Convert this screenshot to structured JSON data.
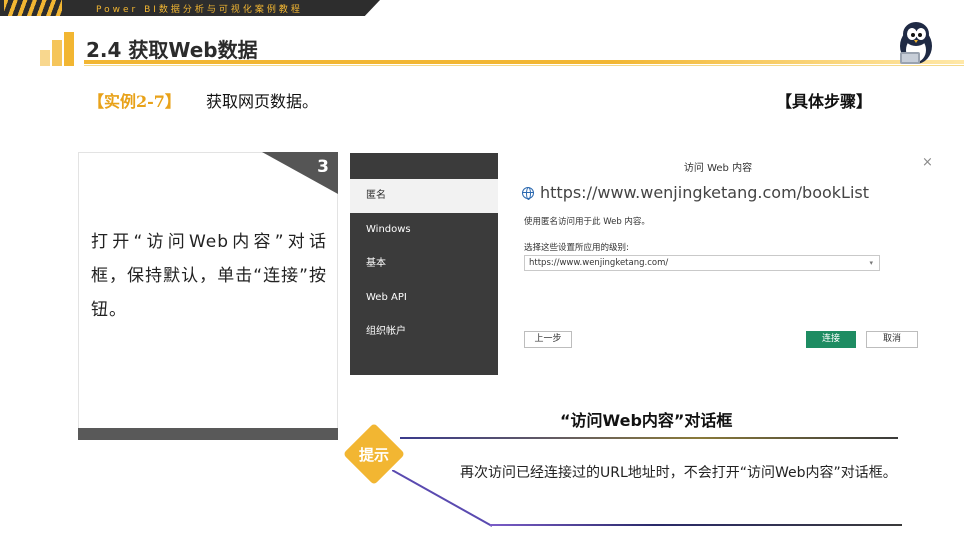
{
  "header": {
    "course": "Power BI数据分析与可视化案例教程",
    "section_title": "2.4 获取Web数据"
  },
  "example": {
    "tag": "【实例2-7】",
    "text": "获取网页数据。",
    "steps_label": "【具体步骤】"
  },
  "step": {
    "number": "3",
    "text": "打开“访问Web内容”对话框，保持默认，单击“连接”按钮。"
  },
  "dialog": {
    "title": "访问 Web 内容",
    "close": "×",
    "sidebar": [
      {
        "label": "匿名",
        "active": true
      },
      {
        "label": "Windows",
        "active": false
      },
      {
        "label": "基本",
        "active": false
      },
      {
        "label": "Web API",
        "active": false
      },
      {
        "label": "组织帐户",
        "active": false
      }
    ],
    "url": "https://www.wenjingketang.com/bookList",
    "anon_text": "使用匿名访问用于此 Web 内容。",
    "level_label": "选择这些设置所应用的级别:",
    "level_value": "https://www.wenjingketang.com/",
    "buttons": {
      "back": "上一步",
      "connect": "连接",
      "cancel": "取消"
    }
  },
  "caption": "“访问Web内容”对话框",
  "tip": {
    "badge": "提示",
    "text": "再次访问已经连接过的URL地址时，不会打开“访问Web内容”对话框。"
  },
  "colors": {
    "accent": "#f2b632",
    "dark": "#3b3b3b",
    "connect": "#1e8c62"
  }
}
